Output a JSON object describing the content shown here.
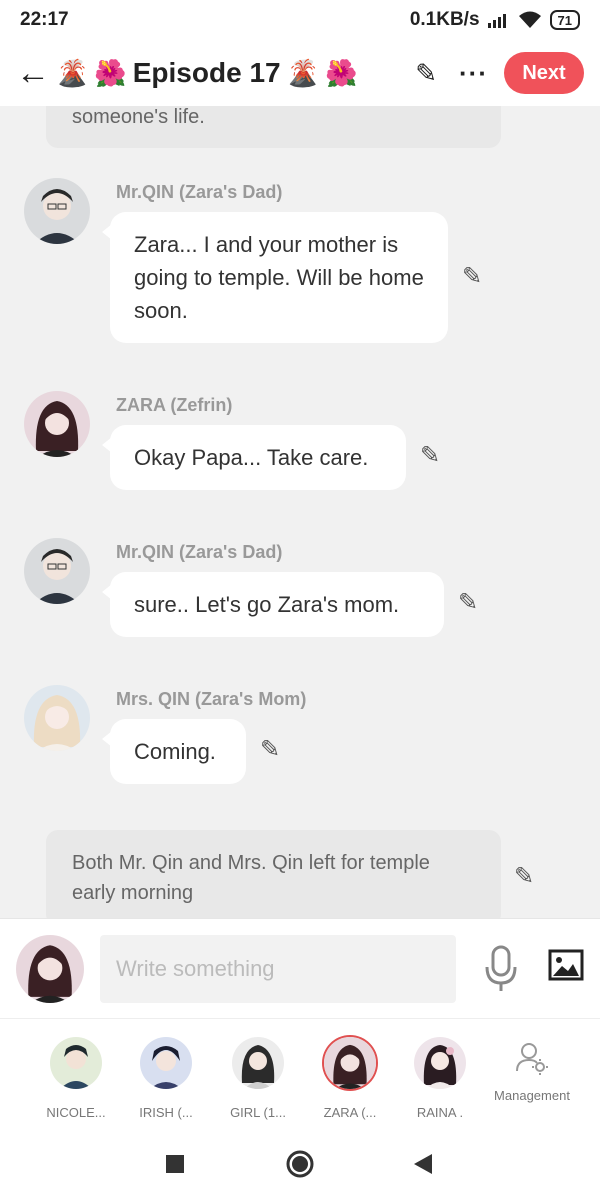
{
  "status": {
    "time": "22:17",
    "speed": "0.1KB/s",
    "battery": "71"
  },
  "header": {
    "title": "Episode 17",
    "next_label": "Next"
  },
  "narration_top": {
    "text": "someone's life."
  },
  "messages": [
    {
      "sender": "Mr.QIN (Zara's Dad)",
      "text": "Zara... I and your mother is going to temple. Will be home soon."
    },
    {
      "sender": "ZARA (Zefrin)",
      "text": "Okay Papa... Take care."
    },
    {
      "sender": "Mr.QIN (Zara's Dad)",
      "text": "sure.. Let's go Zara's mom."
    },
    {
      "sender": "Mrs. QIN (Zara's Mom)",
      "text": "Coming."
    }
  ],
  "narration_bottom": {
    "text": "Both Mr. Qin and Mrs. Qin left for temple early morning"
  },
  "composer": {
    "placeholder": "Write something"
  },
  "characters": [
    {
      "name": "NICOLE..."
    },
    {
      "name": "IRISH (..."
    },
    {
      "name": "GIRL (1..."
    },
    {
      "name": "ZARA (..."
    },
    {
      "name": "RAINA ."
    }
  ],
  "management_label": "Management",
  "colors": {
    "accent": "#f0525a",
    "bubble": "#ffffff",
    "background": "#f1f1f1",
    "narration": "#e8e8e8"
  },
  "icons": [
    "back-arrow-icon",
    "volcano-emoji",
    "hibiscus-emoji",
    "pencil-icon",
    "more-icon",
    "microphone-icon",
    "image-icon",
    "management-user-gear-icon",
    "nav-square-icon",
    "nav-home-icon",
    "nav-back-icon"
  ]
}
